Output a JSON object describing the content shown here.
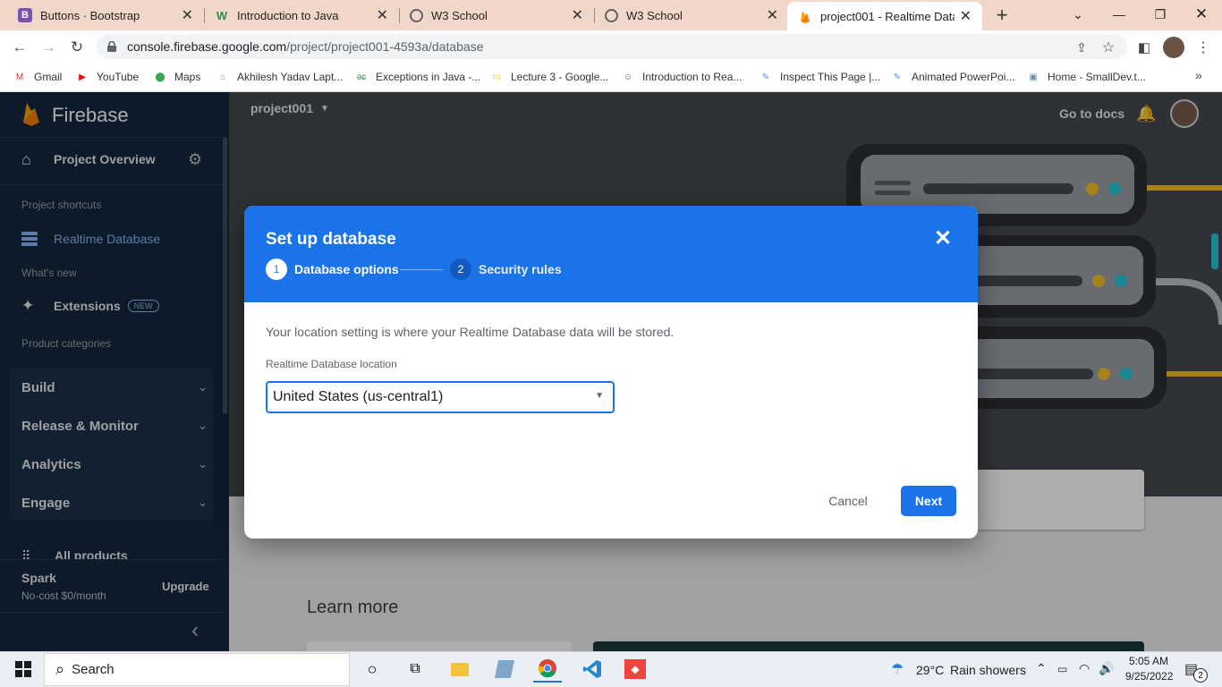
{
  "browser": {
    "tabs": [
      {
        "title": "Buttons · Bootstrap",
        "icon": "bootstrap-icon",
        "letter": "B"
      },
      {
        "title": "Introduction to Java",
        "icon": "geeksforgeeks-icon",
        "letter": "W"
      },
      {
        "title": "W3 School",
        "icon": "globe-icon",
        "letter": ""
      },
      {
        "title": "W3 School",
        "icon": "globe-icon",
        "letter": ""
      },
      {
        "title": "project001 - Realtime Databa",
        "icon": "firebase-icon",
        "letter": ""
      }
    ],
    "new_tab": "+",
    "url_host": "console.firebase.google.com",
    "url_path": "/project/project001-4593a/database",
    "bookmarks": [
      {
        "label": "Gmail",
        "icon": "gmail-icon",
        "glyph": "M",
        "color": "#d93025"
      },
      {
        "label": "YouTube",
        "icon": "youtube-icon",
        "glyph": "▶",
        "color": "#ff0000"
      },
      {
        "label": "Maps",
        "icon": "maps-icon",
        "glyph": "⬤",
        "color": "#34a853"
      },
      {
        "label": "Akhilesh Yadav Lapt...",
        "icon": "site-icon",
        "glyph": "⌂",
        "color": "#888888"
      },
      {
        "label": "Exceptions in Java -...",
        "icon": "geeksforgeeks-icon",
        "glyph": "ǝɕ",
        "color": "#2f8d46"
      },
      {
        "label": "Lecture 3 - Google...",
        "icon": "google-slides-icon",
        "glyph": "▭",
        "color": "#f4b400"
      },
      {
        "label": "Introduction to Rea...",
        "icon": "avatar-icon",
        "glyph": "☺",
        "color": "#7a5c4f"
      },
      {
        "label": "Inspect This Page |...",
        "icon": "chrome-devtools-icon",
        "glyph": "✎",
        "color": "#4a90e2"
      },
      {
        "label": "Animated PowerPoi...",
        "icon": "chrome-devtools-icon",
        "glyph": "✎",
        "color": "#4a90e2"
      },
      {
        "label": "Home - SmallDev.t...",
        "icon": "smalldev-icon",
        "glyph": "▣",
        "color": "#6b8db5"
      }
    ],
    "more_bookmarks": "»"
  },
  "sidebar": {
    "brand": "Firebase",
    "project_overview": "Project Overview",
    "project_shortcuts": "Project shortcuts",
    "realtime_database": "Realtime Database",
    "whats_new": "What's new",
    "extensions": "Extensions",
    "new_badge": "NEW",
    "product_categories": "Product categories",
    "sections": [
      "Build",
      "Release & Monitor",
      "Analytics",
      "Engage"
    ],
    "all_products": "All products",
    "plan_name": "Spark",
    "plan_desc": "No-cost $0/month",
    "upgrade": "Upgrade",
    "collapse_glyph": "‹"
  },
  "topbar": {
    "project_name": "project001",
    "go_to_docs": "Go to docs"
  },
  "main": {
    "learn_more": "Learn more"
  },
  "dialog": {
    "title": "Set up database",
    "steps": [
      {
        "number": "1",
        "label": "Database options"
      },
      {
        "number": "2",
        "label": "Security rules"
      }
    ],
    "description": "Your location setting is where your Realtime Database data will be stored.",
    "location_label": "Realtime Database location",
    "location_value": "United States (us-central1)",
    "cancel": "Cancel",
    "next": "Next"
  },
  "taskbar": {
    "search": "Search",
    "weather_temp": "29°C",
    "weather_text": "Rain showers",
    "time": "5:05 AM",
    "date": "9/25/2022",
    "notification_count": "2"
  },
  "colors": {
    "firebase_blue": "#1a73e8",
    "sidebar_bg": "#13273d",
    "active_link": "#8ab4f8",
    "hero_bg": "#45494e"
  }
}
